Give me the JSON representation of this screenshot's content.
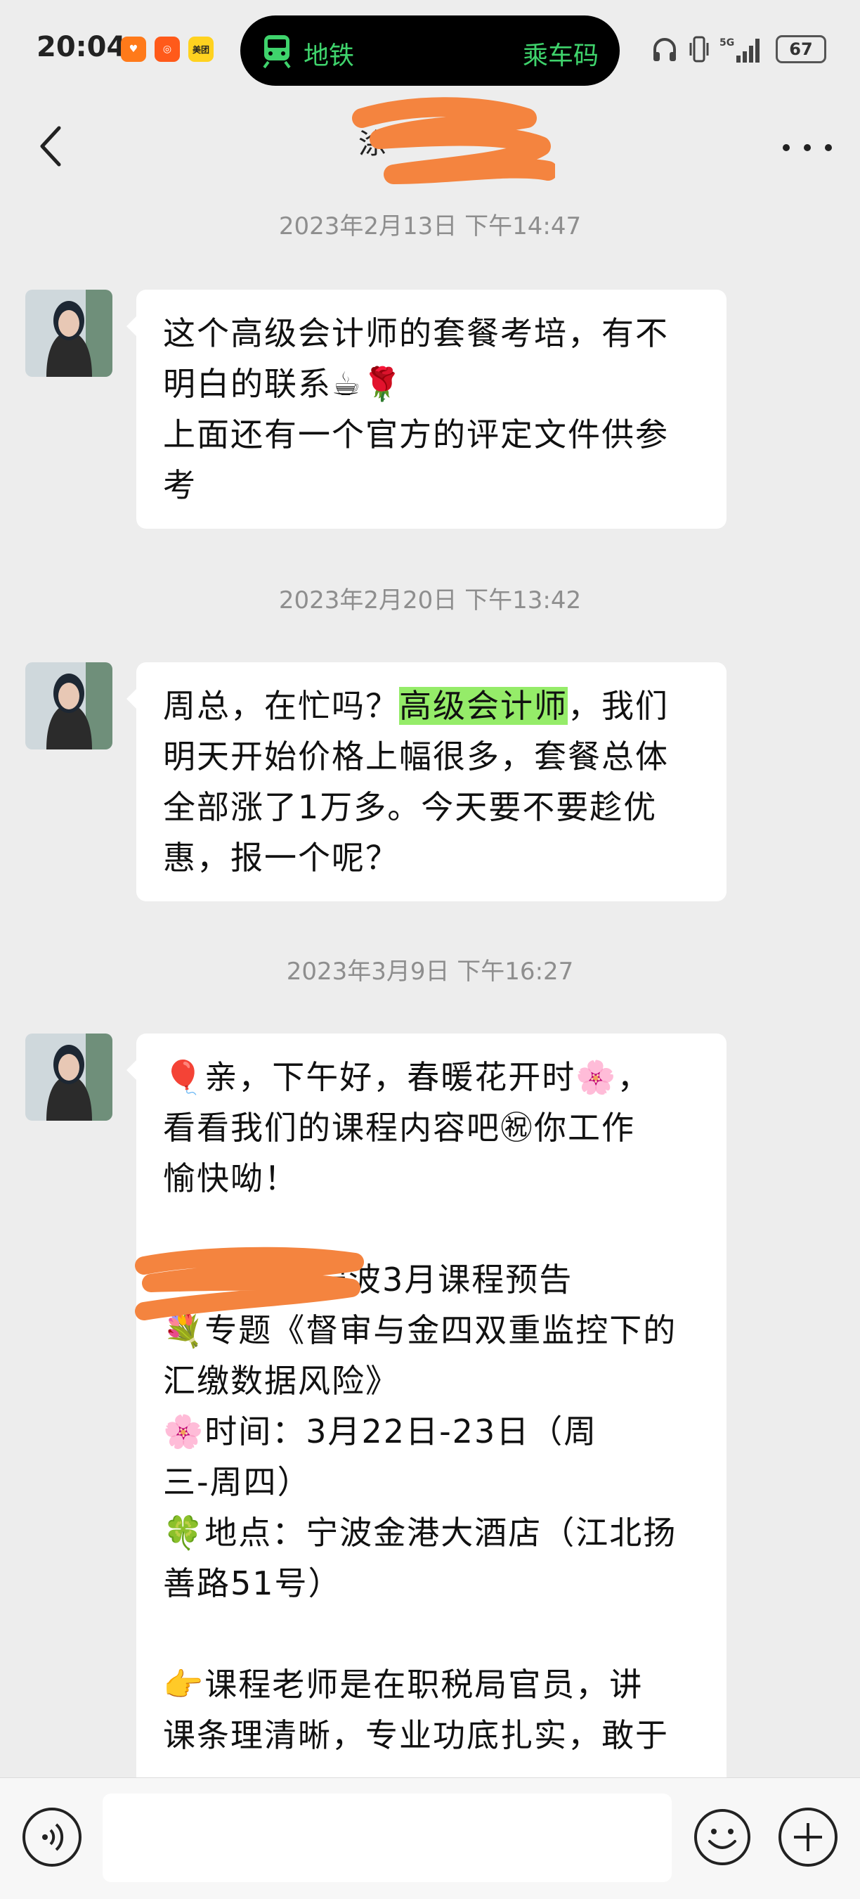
{
  "status_bar": {
    "time": "20:04",
    "apps": [
      "taobao-heart-icon",
      "xiaohongshu-icon",
      "meituan-icon"
    ],
    "meituan_label": "美团",
    "island": {
      "metro_label": "地铁",
      "code_label": "乘车码"
    },
    "battery": "67"
  },
  "nav": {
    "title": "涂"
  },
  "messages": [
    {
      "timestamp": "2023年2月13日 下午14:47",
      "lines": [
        "这个高级会计师的套餐考培，有不",
        "明白的联系☕🌹",
        "上面还有一个官方的评定文件供参",
        "考"
      ]
    },
    {
      "timestamp": "2023年2月20日 下午13:42",
      "line1_pre": "周总，在忙吗？",
      "line1_highlight": "高级会计师",
      "line1_post": "，我们",
      "lines": [
        "明天开始价格上幅很多，套餐总体",
        "全部涨了1万多。今天要不要趁优",
        "惠，报一个呢？"
      ]
    },
    {
      "timestamp": "2023年3月9日 下午16:27",
      "lines": [
        "🎈亲，下午好，春暖花开时🌸，",
        "看看我们的课程内容吧㊗你工作",
        "愉快呦！",
        "",
        "宁波3月课程预告",
        "💐专题《督审与金四双重监控下的",
        "汇缴数据风险》",
        "🌸时间：3月22日-23日（周",
        "三-周四）",
        "🍀地点：宁波金港大酒店（江北扬",
        "善路51号）",
        "",
        "👉课程老师是在职税局官员，讲",
        "课条理清晰，专业功底扎实，敢于"
      ]
    }
  ],
  "colors": {
    "highlight": "#95ec69",
    "metro_green": "#3fd36c",
    "redact": "#f4843f"
  }
}
